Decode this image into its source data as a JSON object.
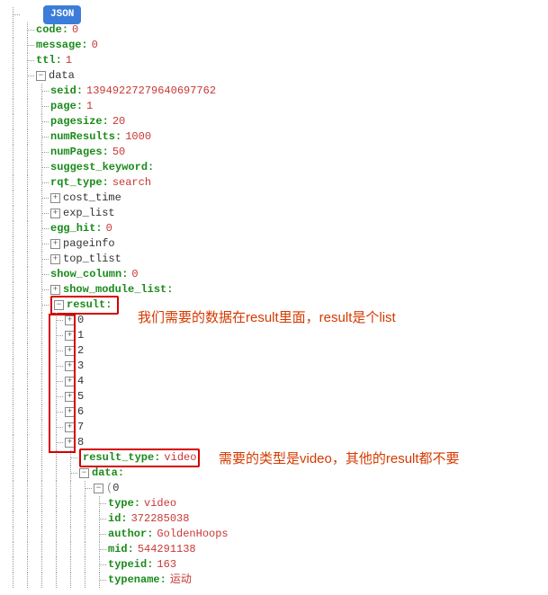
{
  "badge": "JSON",
  "root": {
    "code": {
      "k": "code",
      "v": "0"
    },
    "message": {
      "k": "message",
      "v": "0"
    },
    "ttl": {
      "k": "ttl",
      "v": "1"
    },
    "data": {
      "k": "data"
    },
    "seid": {
      "k": "seid",
      "v": "13949227279640697762"
    },
    "page": {
      "k": "page",
      "v": "1"
    },
    "pagesize": {
      "k": "pagesize",
      "v": "20"
    },
    "numResults": {
      "k": "numResults",
      "v": "1000"
    },
    "numPages": {
      "k": "numPages",
      "v": "50"
    },
    "suggest_keyword": {
      "k": "suggest_keyword",
      "v": ""
    },
    "rqt_type": {
      "k": "rqt_type",
      "v": "search"
    },
    "cost_time": {
      "k": "cost_time"
    },
    "exp_list": {
      "k": "exp_list"
    },
    "egg_hit": {
      "k": "egg_hit",
      "v": "0"
    },
    "pageinfo": {
      "k": "pageinfo"
    },
    "top_tlist": {
      "k": "top_tlist"
    },
    "show_column": {
      "k": "show_column",
      "v": "0"
    },
    "show_module_list": {
      "k": "show_module_list",
      "v": ""
    },
    "result": {
      "k": "result",
      "v": ""
    },
    "result_indices": [
      "0",
      "1",
      "2",
      "3",
      "4",
      "5",
      "6",
      "7",
      "8"
    ],
    "result_type": {
      "k": "result_type",
      "v": "video"
    },
    "data2": {
      "k": "data",
      "v": ""
    },
    "data2_idx": "0",
    "type": {
      "k": "type",
      "v": "video"
    },
    "id": {
      "k": "id",
      "v": "372285038"
    },
    "author": {
      "k": "author",
      "v": "GoldenHoops"
    },
    "mid": {
      "k": "mid",
      "v": "544291138"
    },
    "typeid": {
      "k": "typeid",
      "v": "163"
    },
    "typename": {
      "k": "typename",
      "v": "运动"
    }
  },
  "annotations": {
    "a1": "我们需要的数据在result里面，result是个list",
    "a2": "需要的类型是video，其他的result都不要"
  }
}
